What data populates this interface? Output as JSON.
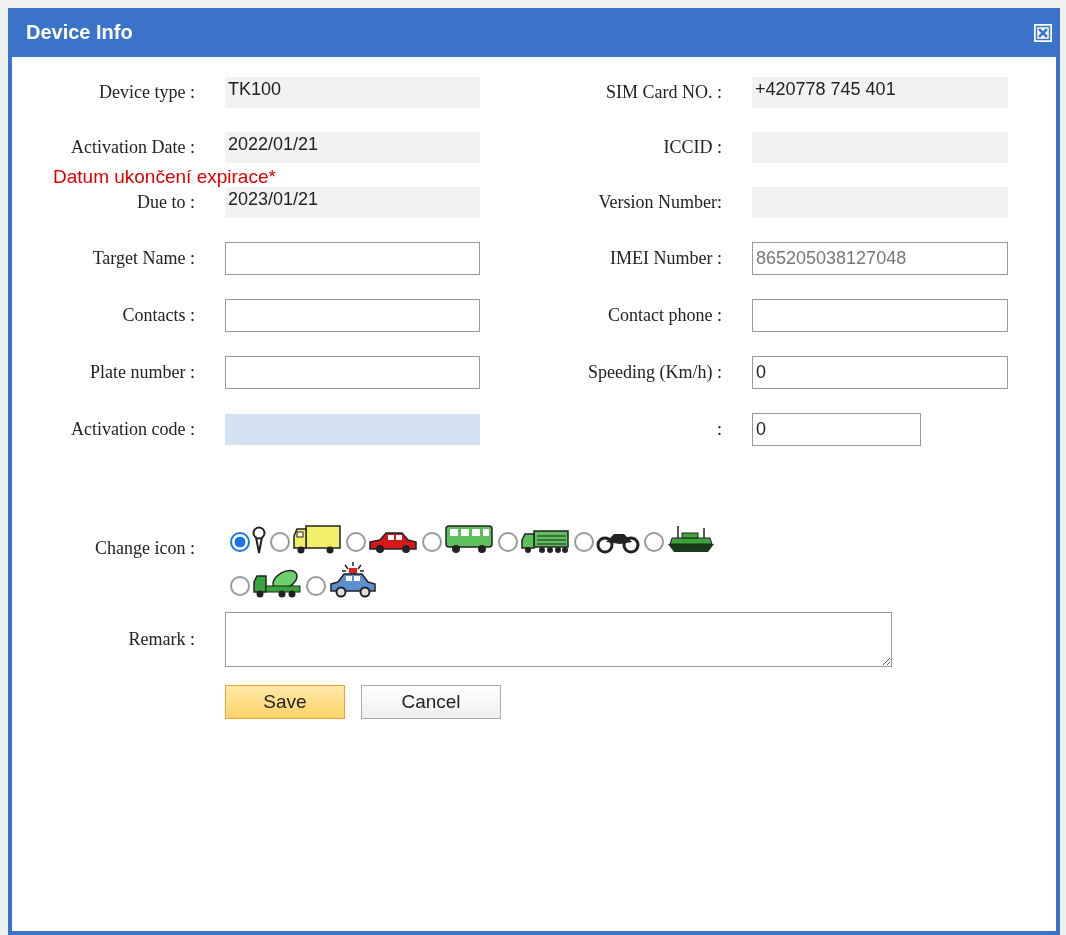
{
  "window": {
    "title": "Device Info"
  },
  "rows": [
    {
      "left": {
        "label": "Device type :",
        "value": "TK100",
        "kind": "readonly"
      },
      "right": {
        "label": "SIM Card NO. :",
        "value": "+420778 745 401",
        "kind": "readonly"
      }
    },
    {
      "left": {
        "label": "Activation Date :",
        "value": "2022/01/21",
        "kind": "readonly"
      },
      "right": {
        "label": "ICCID :",
        "kind": "readonly"
      }
    },
    {
      "left": {
        "label": "Due to :",
        "value": "2023/01/21",
        "kind": "readonly",
        "note": "Datum ukončení expirace*"
      },
      "right": {
        "label": "Version Number:",
        "kind": "readonly"
      }
    },
    {
      "left": {
        "label": "Target Name :",
        "kind": "input"
      },
      "right": {
        "label": "IMEI Number :",
        "value": "865205038127048",
        "kind": "input",
        "disabled": true
      }
    },
    {
      "left": {
        "label": "Contacts :",
        "kind": "input"
      },
      "right": {
        "label": "Contact phone :",
        "kind": "input"
      }
    },
    {
      "left": {
        "label": "Plate number :",
        "kind": "input"
      },
      "right": {
        "label": "Speeding (Km/h) :",
        "value": "0",
        "kind": "input"
      }
    },
    {
      "left": {
        "label": "Activation code :",
        "kind": "code"
      },
      "right": {
        "label": ":",
        "value": "0",
        "kind": "short_input"
      }
    }
  ],
  "icon_picker": {
    "label": "Change icon :",
    "options": [
      {
        "kind": "pin",
        "selected": true
      },
      {
        "kind": "truck",
        "selected": false
      },
      {
        "kind": "car",
        "selected": false
      },
      {
        "kind": "bus",
        "selected": false
      },
      {
        "kind": "lorry",
        "selected": false
      },
      {
        "kind": "motorcycle",
        "selected": false
      },
      {
        "kind": "ship",
        "selected": false
      },
      {
        "kind": "mixer",
        "selected": false
      },
      {
        "kind": "police_car",
        "selected": false
      }
    ]
  },
  "remark": {
    "label": "Remark :"
  },
  "buttons": [
    {
      "label": "Save",
      "kind": "primary"
    },
    {
      "label": "Cancel",
      "kind": "secondary"
    }
  ]
}
